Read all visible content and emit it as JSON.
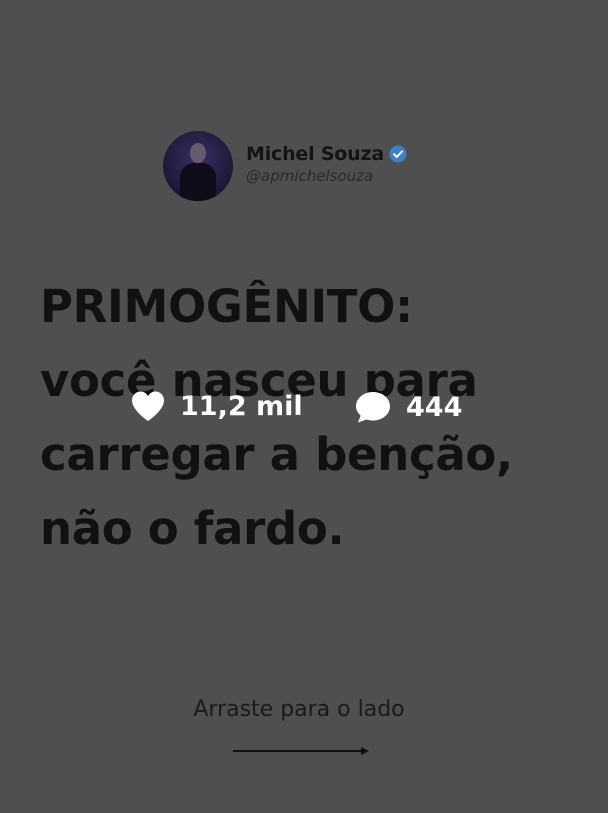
{
  "author": {
    "name": "Michel Souza",
    "handle": "@apmichelsouza",
    "avatar_icon": "profile-photo",
    "verified_icon": "verified-badge-icon",
    "verified_color": "#3b82c4"
  },
  "headline": {
    "line1": "PRIMOGÊNITO:",
    "line2": "você nasceu para",
    "line3": "carregar a benção,",
    "line4": "não o fardo."
  },
  "stats": {
    "likes": "11,2 mil",
    "comments": "444",
    "likes_icon": "heart-icon",
    "comments_icon": "comment-bubble-icon"
  },
  "swipe": {
    "label": "Arraste para o lado",
    "arrow_icon": "arrow-right-icon"
  },
  "colors": {
    "background": "#4f4f4f",
    "text": "#111111",
    "overlay_text": "#ffffff"
  }
}
